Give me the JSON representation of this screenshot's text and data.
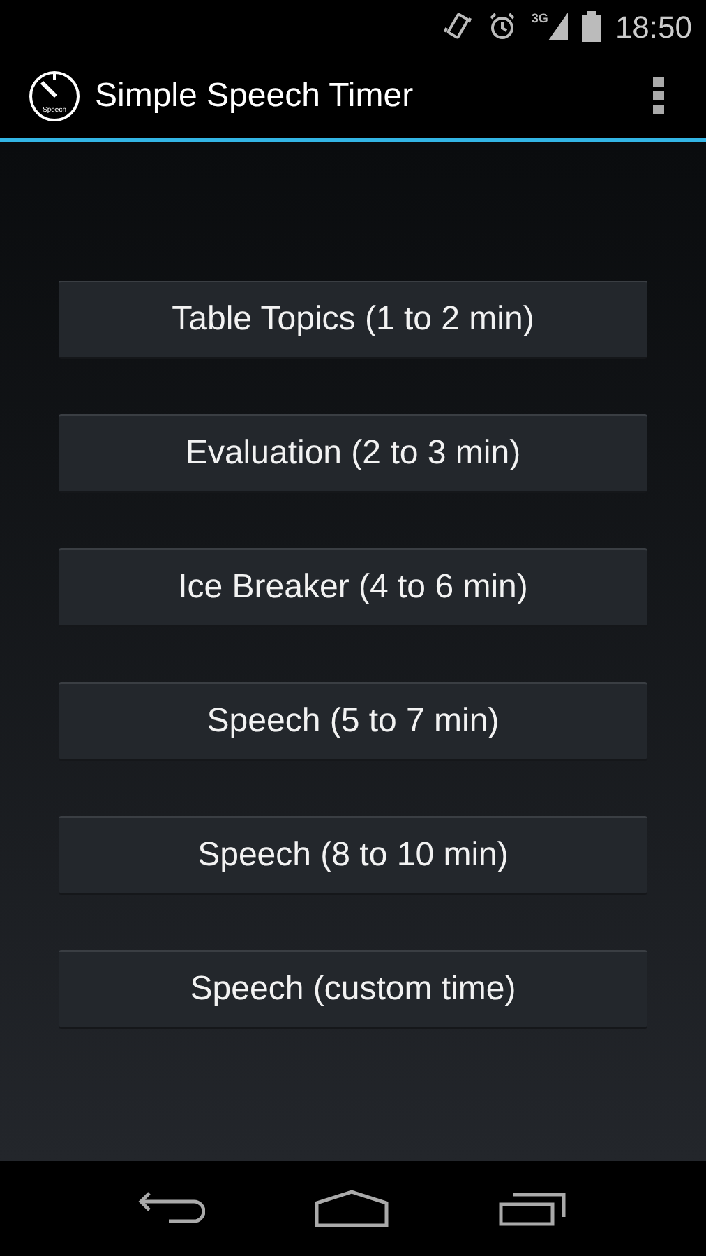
{
  "status_bar": {
    "network": "3G",
    "time": "18:50"
  },
  "action_bar": {
    "logo_text": "Speech",
    "title": "Simple Speech Timer"
  },
  "buttons": [
    {
      "label": "Table Topics (1 to 2 min)"
    },
    {
      "label": "Evaluation (2 to 3 min)"
    },
    {
      "label": "Ice Breaker (4 to 6 min)"
    },
    {
      "label": "Speech (5 to 7 min)"
    },
    {
      "label": "Speech (8 to 10 min)"
    },
    {
      "label": "Speech (custom time)"
    }
  ]
}
